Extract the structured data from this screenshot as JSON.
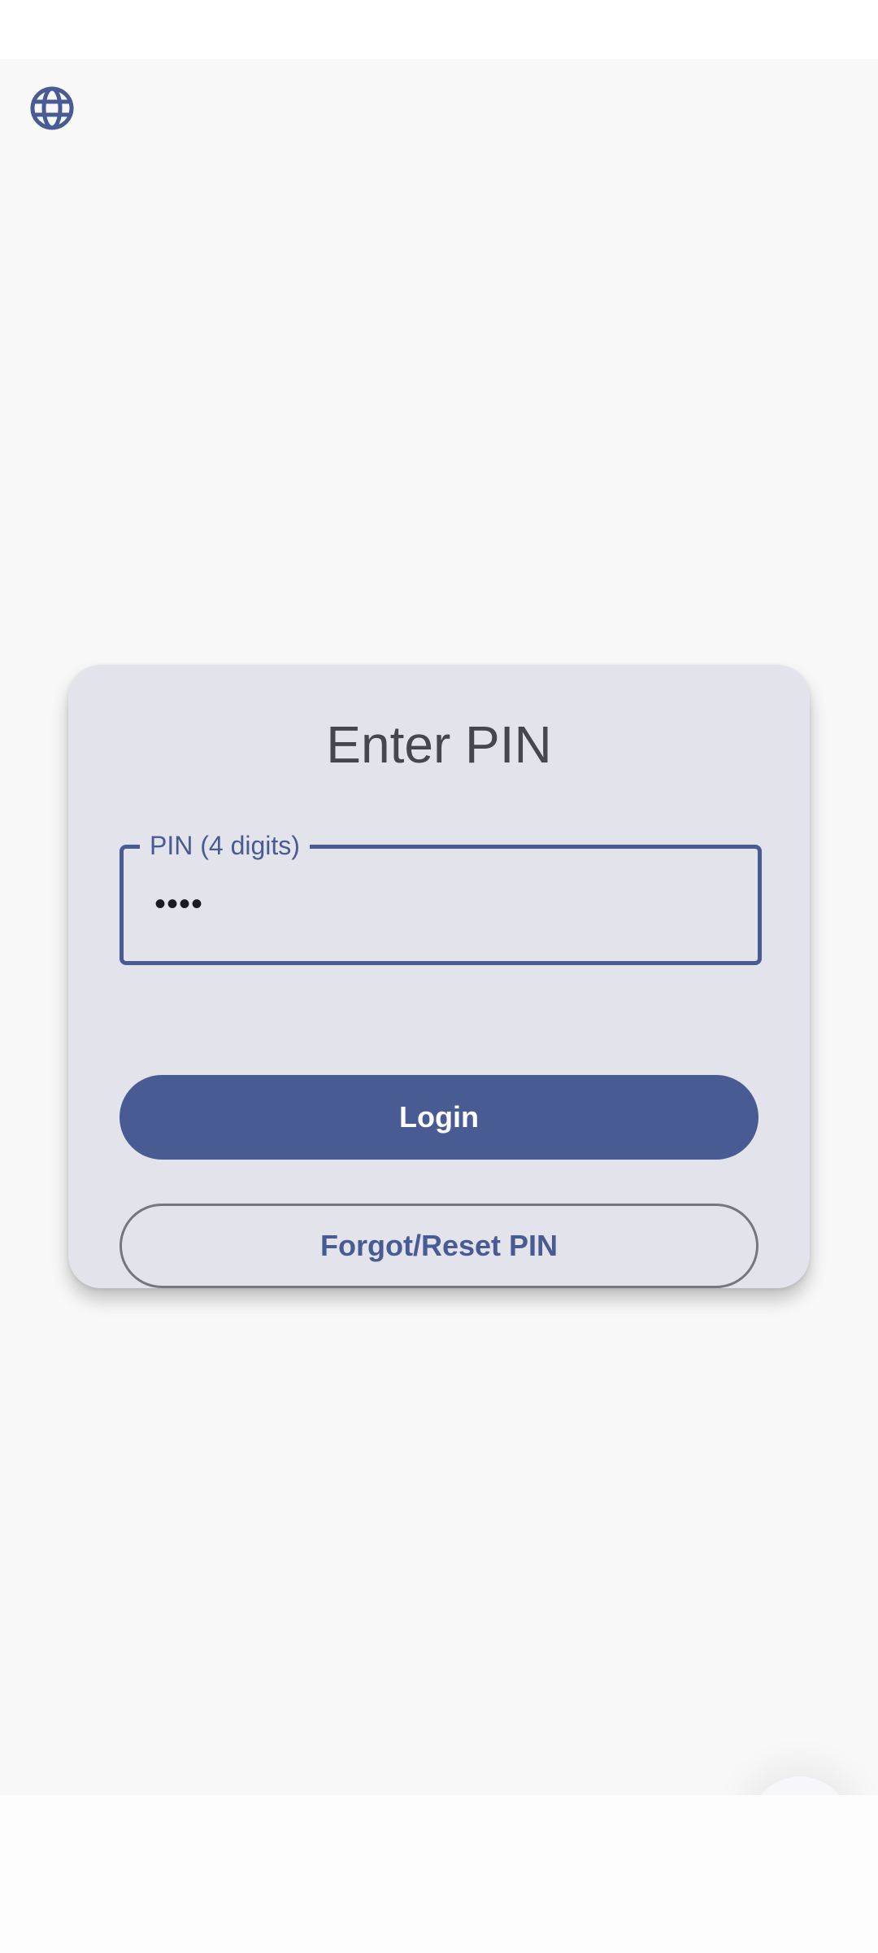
{
  "header": {
    "language_icon": "globe-icon"
  },
  "pin_card": {
    "title": "Enter PIN",
    "pin_field": {
      "label": "PIN (4 digits)",
      "value": "••••"
    },
    "login_label": "Login",
    "reset_label": "Forgot/Reset PIN"
  },
  "colors": {
    "primary": "#485b92",
    "card_background": "#e3e3ec",
    "app_background": "#f8f8f8",
    "title_text": "#45464f",
    "outline": "#75777f"
  }
}
